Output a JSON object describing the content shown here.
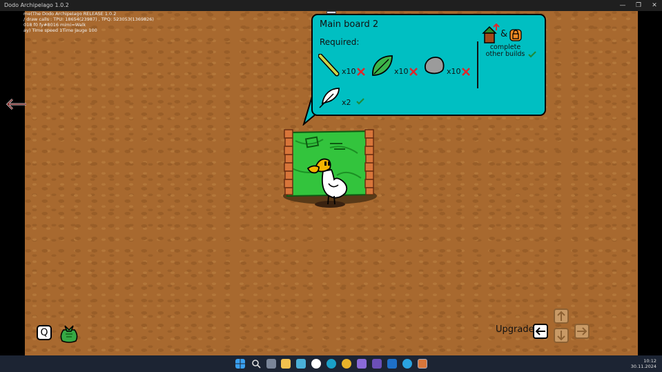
{
  "window": {
    "title": "Dodo Archipelago 1.0.2",
    "minimize": "—",
    "restore": "❐",
    "close": "✕"
  },
  "debug": [
    "me(The Dodo Archipelago RELEASE 1.0.2",
    "/ draw calls : TPU: 18654(23987) , TPQ: 523053(1369826)",
    "018 f0 fy#8016 mimi=Walk",
    "ay) Time speed 1Time jauge 100"
  ],
  "bubble": {
    "title": "Main board 2",
    "required_label": "Required:",
    "items": [
      {
        "icon": "stick-icon",
        "qty": "x10",
        "status": "missing"
      },
      {
        "icon": "leaf-icon",
        "qty": "x10",
        "status": "missing"
      },
      {
        "icon": "stone-icon",
        "qty": "x10",
        "status": "missing"
      },
      {
        "icon": "feather-icon",
        "qty": "x2",
        "status": "done"
      }
    ],
    "condition": {
      "amp": "&",
      "text_1": "complete",
      "text_2": "other builds",
      "status": "done"
    }
  },
  "controls": {
    "q_key": "Q",
    "upgrade_label": "Upgrade"
  },
  "clock": {
    "time": "10:12",
    "date": "30.11.2024"
  },
  "colors": {
    "bubble": "#00bfc2",
    "ground": "#a8692f",
    "board": "#30c23a",
    "cross": "#e0262a",
    "check": "#1e8a3a"
  }
}
